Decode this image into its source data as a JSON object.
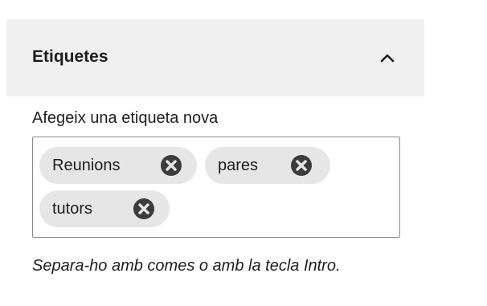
{
  "panel": {
    "title": "Etiquetes",
    "toggle_icon": "chevron-up-icon"
  },
  "tags_field": {
    "label": "Afegeix una etiqueta nova",
    "tokens": [
      {
        "label": "Reunions",
        "remove_icon": "circle-x-icon"
      },
      {
        "label": "pares",
        "remove_icon": "circle-x-icon"
      },
      {
        "label": "tutors",
        "remove_icon": "circle-x-icon"
      }
    ],
    "help_text": "Separa-ho amb comes o amb la tecla Intro."
  },
  "colors": {
    "header_bg": "#f0f0f0",
    "token_bg": "#e6e6e6",
    "icon": "#3c3c3c",
    "border": "#8a8a8a"
  }
}
